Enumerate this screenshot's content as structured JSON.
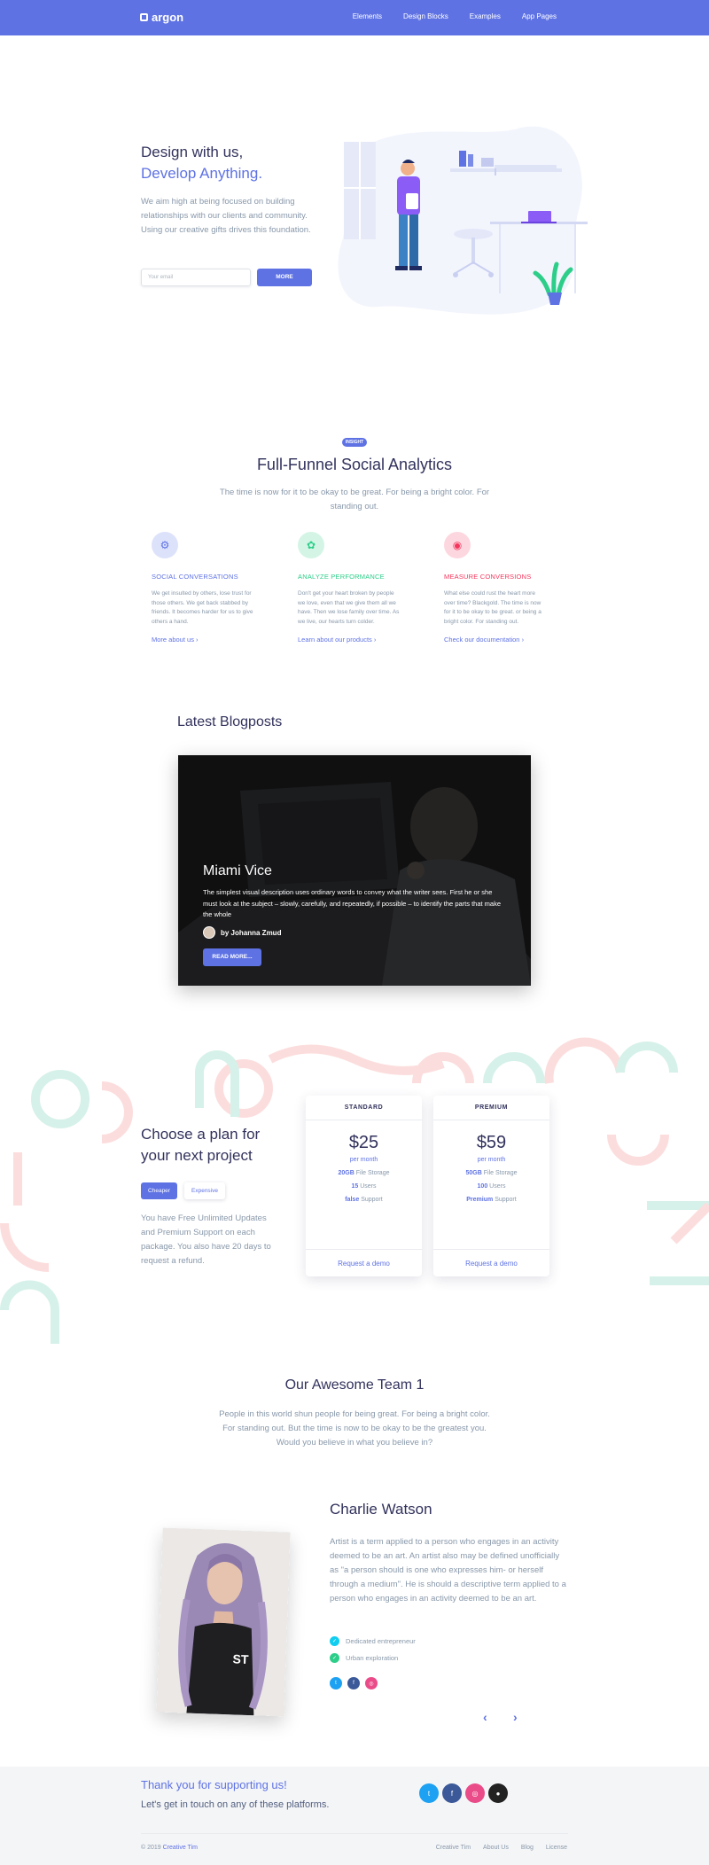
{
  "nav": {
    "brand": "argon",
    "links": [
      "Elements",
      "Design Blocks",
      "Examples",
      "App Pages"
    ]
  },
  "hero": {
    "title_line1": "Design with us,",
    "title_line2": "Develop Anything.",
    "text": "We aim high at being focused on building relationships with our clients and community. Using our creative gifts drives this foundation.",
    "email_placeholder": "Your email",
    "button": "MORE"
  },
  "insight": {
    "badge": "INSIGHT",
    "title": "Full-Funnel Social Analytics",
    "subtitle": "The time is now for it to be okay to be great. For being a bright color. For standing out.",
    "features": [
      {
        "icon": "settings-gear-icon",
        "title": "SOCIAL CONVERSATIONS",
        "text": "We get insulted by others, lose trust for those others. We get back stabbed by friends. It becomes harder for us to give others a hand.",
        "link": "More about us",
        "color": "#5e72e4",
        "bg": "#dde2fb"
      },
      {
        "icon": "cog-icon",
        "title": "ANALYZE PERFORMANCE",
        "text": "Don't get your heart broken by people we love, even that we give them all we have. Then we lose family over time. As we live, our hearts turn colder.",
        "link": "Learn about our products",
        "color": "#2dce89",
        "bg": "#d4f5e6"
      },
      {
        "icon": "globe-icon",
        "title": "MEASURE CONVERSIONS",
        "text": "What else could rust the heart more over time? Blackgold. The time is now for it to be okay to be great. or being a bright color. For standing out.",
        "link": "Check our documentation",
        "color": "#f5365c",
        "bg": "#fdd7df"
      }
    ]
  },
  "blog": {
    "heading": "Latest Blogposts",
    "card_title": "Miami Vice",
    "card_text": "The simplest visual description uses ordinary words to convey what the writer sees. First he or she must look at the subject – slowly, carefully, and repeatedly, if possible – to identify the parts that make the whole",
    "author": "by Johanna Zmud",
    "button": "READ MORE..."
  },
  "pricing": {
    "heading": "Choose a plan for your next project",
    "tab_active": "Cheaper",
    "tab_inactive": "Expensive",
    "text": "You have Free Unlimited Updates and Premium Support on each package. You also have 20 days to request a refund.",
    "plans": [
      {
        "name": "STANDARD",
        "price": "$25",
        "per": "per month",
        "storage_val": "20GB",
        "storage_lbl": "File Storage",
        "users_val": "15",
        "users_lbl": "Users",
        "support_val": "false",
        "support_lbl": "Support",
        "cta": "Request a demo"
      },
      {
        "name": "PREMIUM",
        "price": "$59",
        "per": "per month",
        "storage_val": "50GB",
        "storage_lbl": "File Storage",
        "users_val": "100",
        "users_lbl": "Users",
        "support_val": "Premium",
        "support_lbl": "Support",
        "cta": "Request a demo"
      }
    ]
  },
  "team": {
    "heading": "Our Awesome Team 1",
    "subtitle": "People in this world shun people for being great. For being a bright color. For standing out. But the time is now to be okay to be the greatest you. Would you believe in what you believe in?",
    "name": "Charlie Watson",
    "bio": "Artist is a term applied to a person who engages in an activity deemed to be an art. An artist also may be defined unofficially as \"a person should is one who expresses him- or herself through a medium\". He is should a descriptive term applied to a person who engages in an activity deemed to be an art.",
    "traits": [
      {
        "label": "Dedicated entrepreneur",
        "color": "#11cdef"
      },
      {
        "label": "Urban exploration",
        "color": "#2dce89"
      }
    ],
    "socials": [
      {
        "icon": "twitter-icon",
        "glyph": "t",
        "color": "#1da1f2"
      },
      {
        "icon": "facebook-icon",
        "glyph": "f",
        "color": "#3b5999"
      },
      {
        "icon": "dribbble-icon",
        "glyph": "◎",
        "color": "#ea4c89"
      }
    ],
    "prev": "‹",
    "next": "›"
  },
  "footer": {
    "thanks": "Thank you for supporting us!",
    "touch": "Let's get in touch on any of these platforms.",
    "socials": [
      {
        "icon": "twitter-icon",
        "glyph": "t",
        "color": "#1da1f2"
      },
      {
        "icon": "facebook-icon",
        "glyph": "f",
        "color": "#3b5999"
      },
      {
        "icon": "dribbble-icon",
        "glyph": "◎",
        "color": "#ea4c89"
      },
      {
        "icon": "github-icon",
        "glyph": "●",
        "color": "#222222"
      }
    ],
    "copyright": "© 2019",
    "copyright_link": "Creative Tim",
    "links": [
      "Creative Tim",
      "About Us",
      "Blog",
      "License"
    ]
  }
}
